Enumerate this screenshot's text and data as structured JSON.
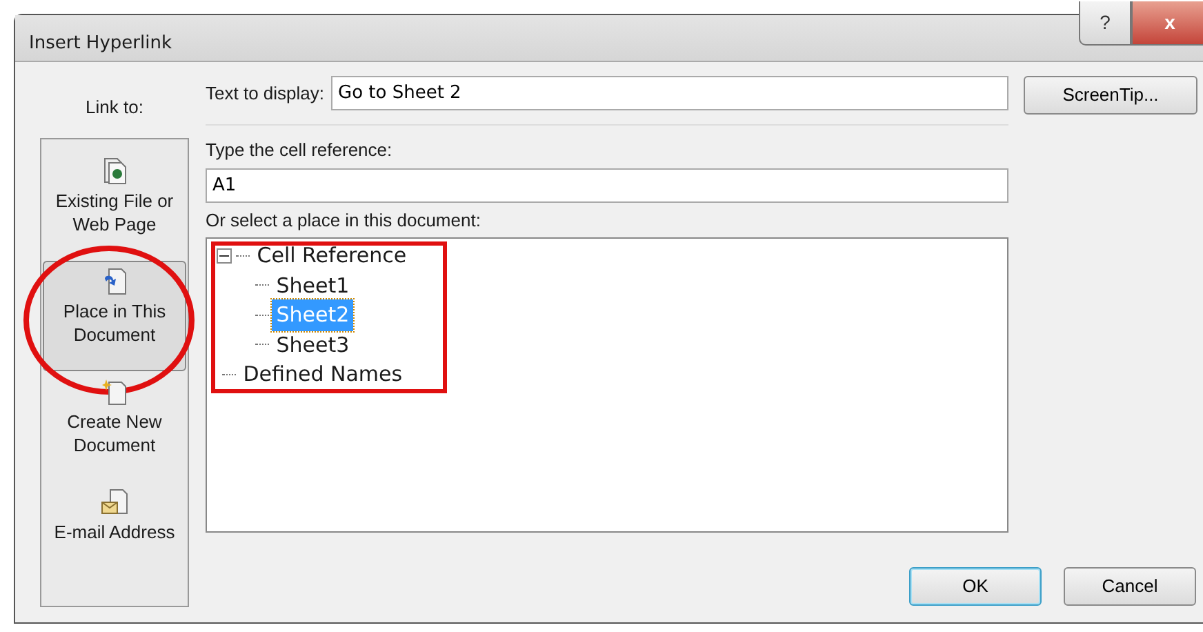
{
  "window": {
    "title": "Insert Hyperlink",
    "buttons": [
      "?",
      "x"
    ]
  },
  "link_to": {
    "label": "Link to:",
    "items": [
      {
        "label": "Existing File or Web Page",
        "kind": "file",
        "selected": false,
        "circled": false
      },
      {
        "label": "Place in This Document",
        "kind": "place",
        "selected": true,
        "circled": true
      },
      {
        "label": "Create New Document",
        "kind": "new",
        "selected": false,
        "circled": false
      },
      {
        "label": "E-mail Address",
        "kind": "email",
        "selected": false,
        "circled": false
      }
    ]
  },
  "text_to_display": {
    "label": "Text to display:",
    "value": "Go to Sheet 2"
  },
  "screentip_button": "ScreenTip...",
  "cell_reference": {
    "label": "Type the cell reference:",
    "value": "A1"
  },
  "place_tree": {
    "label": "Or select a place in this document:",
    "outlined": true,
    "items": [
      {
        "label": "Cell Reference",
        "expanded": true,
        "selected": false,
        "children": [
          {
            "label": "Sheet1",
            "selected": false
          },
          {
            "label": "Sheet2",
            "selected": true
          },
          {
            "label": "Sheet3",
            "selected": false
          }
        ]
      },
      {
        "label": "Defined Names",
        "selected": false
      }
    ]
  },
  "buttons": [
    {
      "label": "OK",
      "default": true
    },
    {
      "label": "Cancel",
      "default": false
    }
  ]
}
